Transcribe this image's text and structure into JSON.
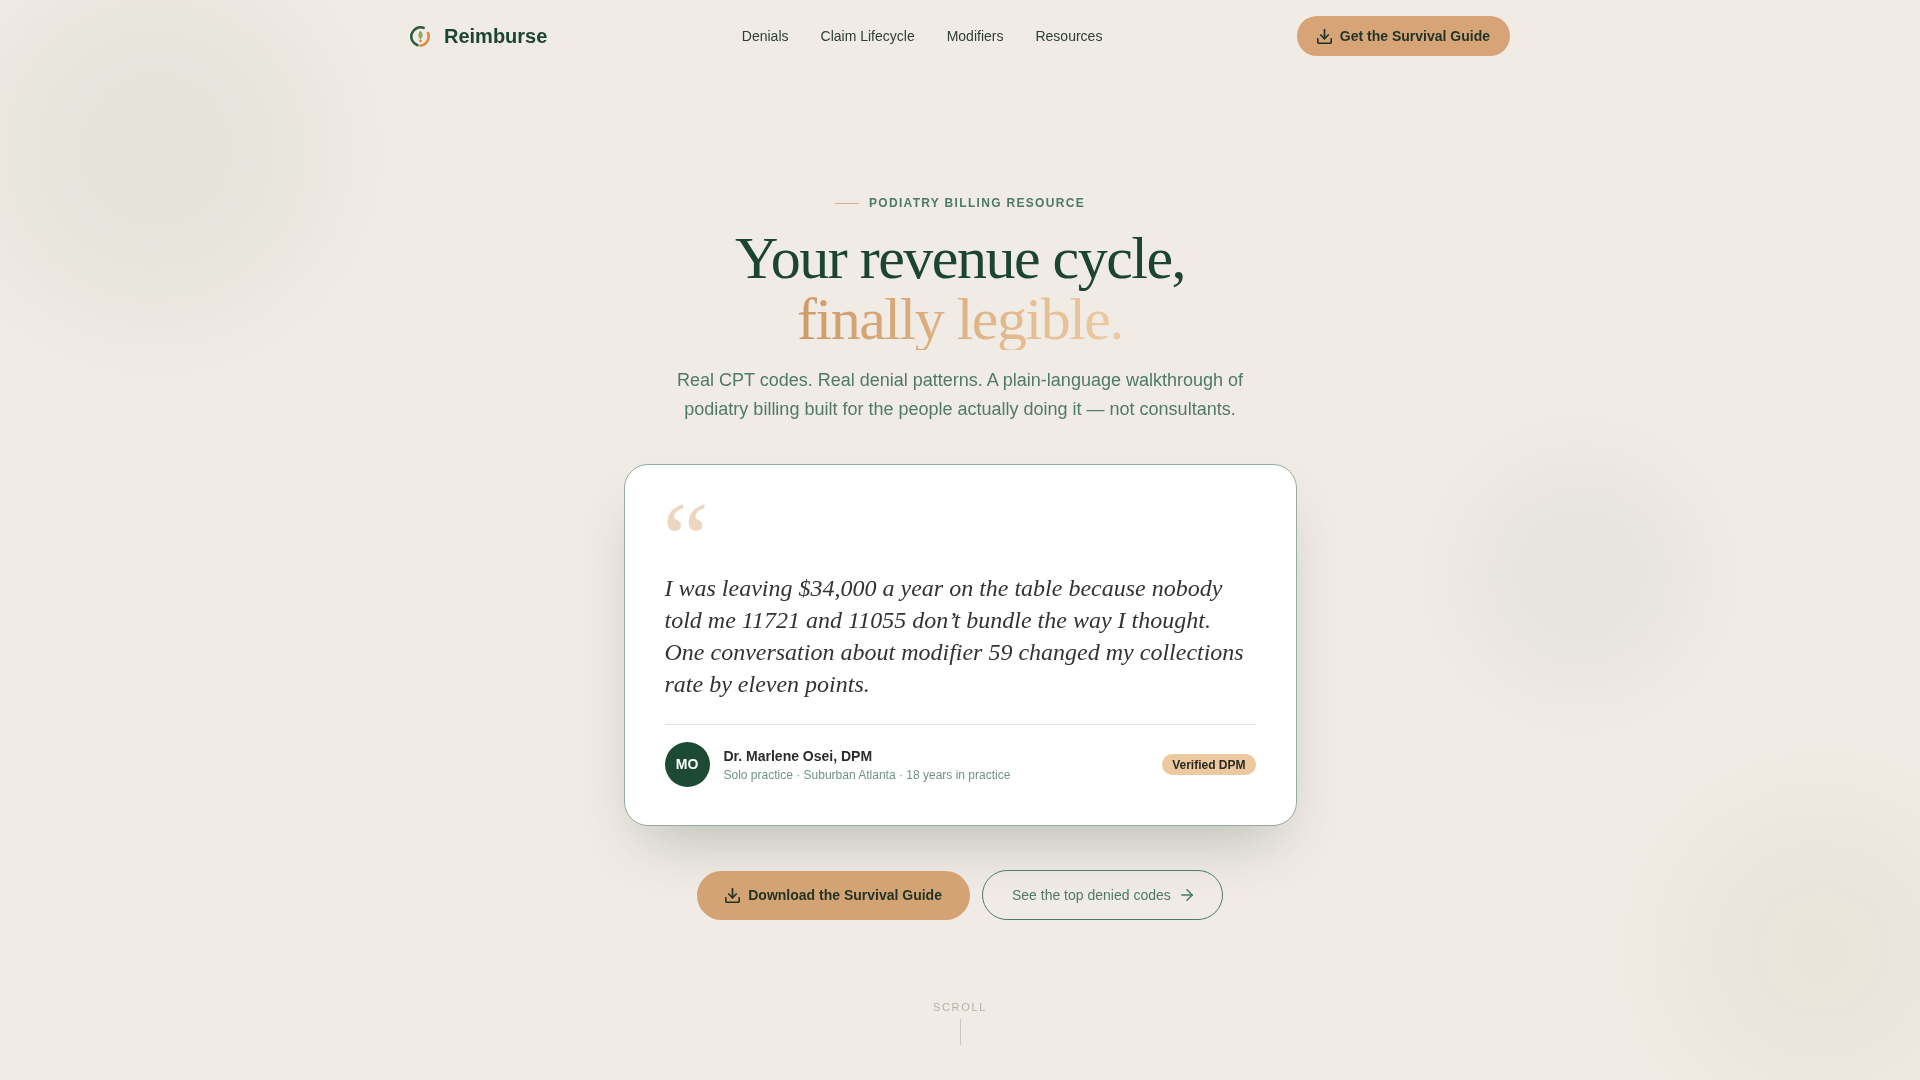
{
  "nav": {
    "brand": "Reimburse",
    "links": [
      "Denials",
      "Claim Lifecycle",
      "Modifiers",
      "Resources"
    ],
    "cta": "Get the Survival Guide"
  },
  "hero": {
    "eyebrow": "PODIATRY BILLING RESOURCE",
    "headline": "Your revenue cycle,",
    "headline_accent": "finally legible.",
    "subtitle": "Real CPT codes. Real denial patterns. A plain-language walkthrough of podiatry billing built for the people actually doing it — not consultants."
  },
  "testimonial": {
    "quote_mark": "“",
    "quote": "I was leaving $34,000 a year on the table because nobody told me 11721 and 11055 don’t bundle the way I thought. One conversation about modifier 59 changed my collections rate by eleven points.",
    "author": {
      "initials": "MO",
      "name": "Dr. Marlene Osei, DPM",
      "details": "Solo practice · Suburban Atlanta · 18 years in practice",
      "badge": "Verified DPM"
    }
  },
  "actions": [
    {
      "kind": "primary",
      "label": "Download the Survival Guide"
    },
    {
      "kind": "secondary",
      "label": "See the top denied codes"
    }
  ],
  "scroll_hint": "SCROLL"
}
